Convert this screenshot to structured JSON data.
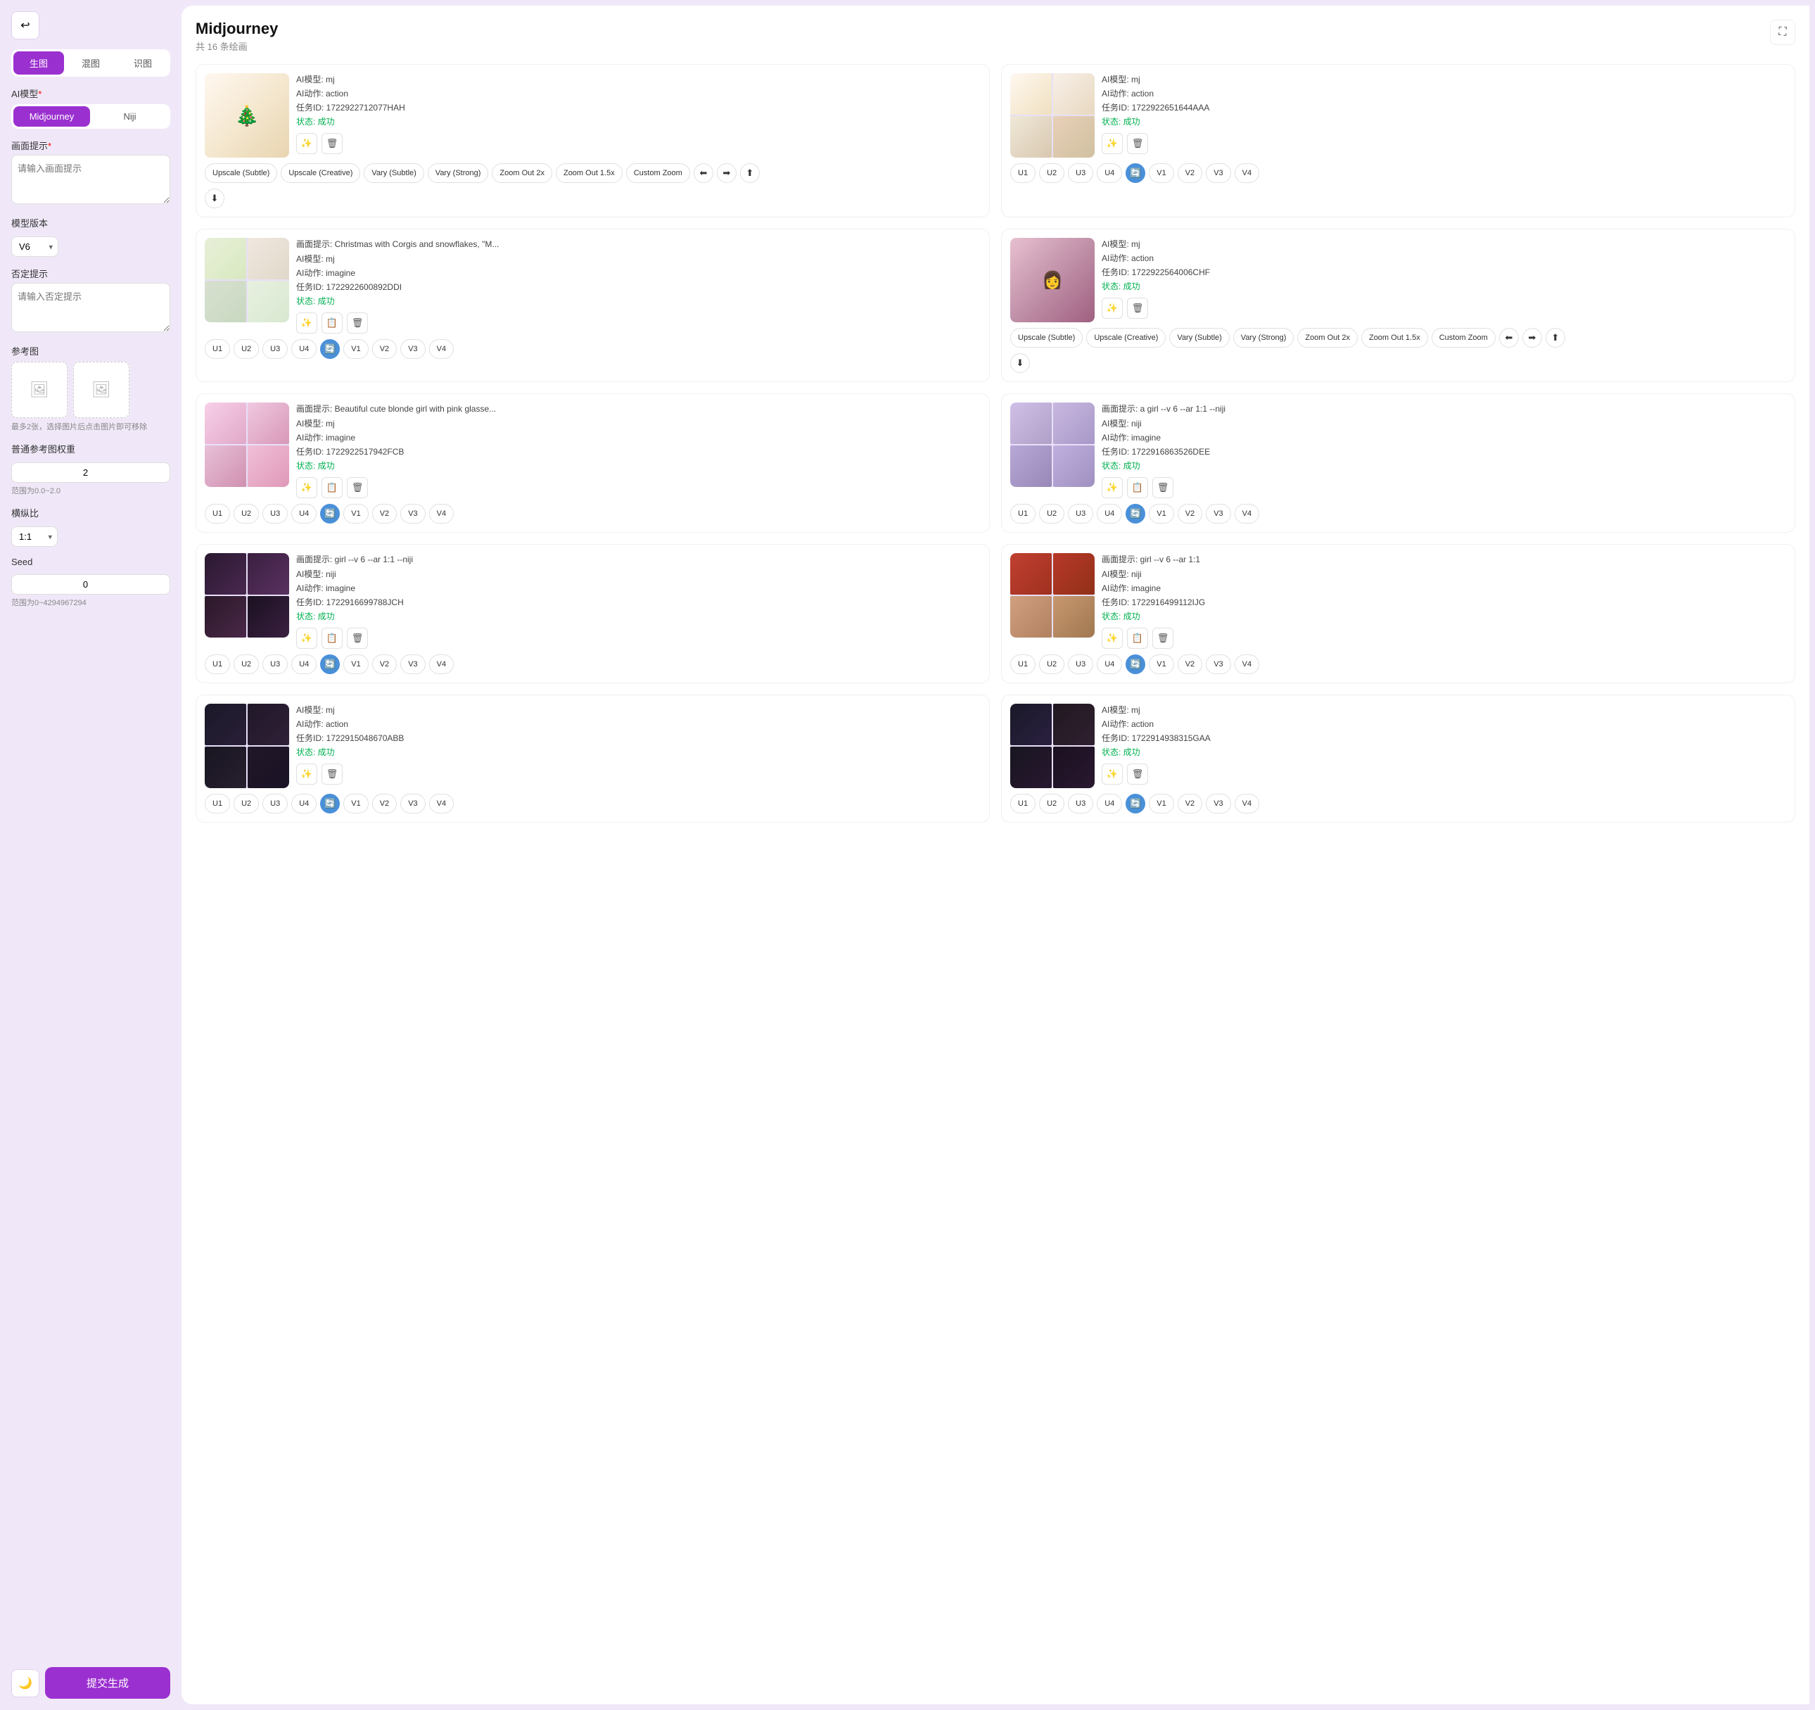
{
  "sidebar": {
    "back_icon": "↩",
    "tabs": [
      "生图",
      "混图",
      "识图"
    ],
    "active_tab": 0,
    "ai_model_label": "AI模型",
    "models": [
      "Midjourney",
      "Niji"
    ],
    "active_model": 0,
    "prompt_label": "画面提示",
    "prompt_placeholder": "请输入画面提示",
    "version_label": "模型版本",
    "version_default": "V6",
    "negative_label": "否定提示",
    "negative_placeholder": "请输入否定提示",
    "ref_label": "参考图",
    "ref_hint": "最多2张，选择图片后点击图片即可移除",
    "ref_weight_label": "普通参考图权重",
    "ref_weight_value": "2",
    "ref_weight_range": "范围为0.0~2.0",
    "aspect_label": "横纵比",
    "aspect_default": "1:1",
    "seed_label": "Seed",
    "seed_value": "0",
    "seed_range": "范围为0~4294967294",
    "submit_label": "提交生成",
    "bottom_icon": "🌙"
  },
  "main": {
    "title": "Midjourney",
    "subtitle": "共 16 条绘画",
    "expand_icon": "⛶",
    "cards": [
      {
        "id": 1,
        "image_type": "christmas_multi",
        "model": "AI模型: mj",
        "action": "AI动作: action",
        "task_id": "任务ID: 1722922712077HAH",
        "status": "状态: 成功",
        "buttons_top": [
          "Upscale (Subtle)",
          "Upscale (Creative)",
          "Vary (Subtle)",
          "Vary (Strong)",
          "Zoom Out 2x",
          "Zoom Out 1.5x",
          "Custom Zoom",
          "⬅",
          "➡",
          "⬆"
        ],
        "buttons_bottom": [
          "⬇"
        ]
      },
      {
        "id": 2,
        "image_type": "christmas_single",
        "model": "AI模型: mj",
        "action": "AI动作: action",
        "task_id": "任务ID: 1722922651644AAA",
        "status": "状态: 成功",
        "buttons_row": [
          "U1",
          "U2",
          "U3",
          "U4",
          "🔄",
          "V1",
          "V2",
          "V3",
          "V4"
        ]
      },
      {
        "id": 3,
        "prompt": "画面提示: Christmas with Corgis and snowflakes, \"M...",
        "image_type": "christmas_grid",
        "model": "AI模型: mj",
        "action": "AI动作: imagine",
        "task_id": "任务ID: 1722922600892DDI",
        "status": "状态: 成功",
        "buttons_row": [
          "U1",
          "U2",
          "U3",
          "U4",
          "🔄",
          "V1",
          "V2",
          "V3",
          "V4"
        ]
      },
      {
        "id": 4,
        "image_type": "girl_portrait",
        "model": "AI模型: mj",
        "action": "AI动作: action",
        "task_id": "任务ID: 1722922564006CHF",
        "status": "状态: 成功",
        "buttons_top": [
          "Upscale (Subtle)",
          "Upscale (Creative)",
          "Vary (Subtle)",
          "Vary (Strong)",
          "Zoom Out 2x",
          "Zoom Out 1.5x",
          "Custom Zoom",
          "⬅",
          "➡",
          "⬆"
        ],
        "buttons_bottom": [
          "⬇"
        ]
      },
      {
        "id": 5,
        "prompt": "画面提示: Beautiful cute blonde girl with pink glasse...",
        "image_type": "girl_pink_grid",
        "model": "AI模型: mj",
        "action": "AI动作: imagine",
        "task_id": "任务ID: 1722922517942FCB",
        "status": "状态: 成功",
        "buttons_row": [
          "U1",
          "U2",
          "U3",
          "U4",
          "🔄",
          "V1",
          "V2",
          "V3",
          "V4"
        ]
      },
      {
        "id": 6,
        "prompt": "画面提示: a girl --v 6 --ar 1:1 --niji",
        "image_type": "girl_niji_grid",
        "model": "AI模型: niji",
        "action": "AI动作: imagine",
        "task_id": "任务ID: 1722916863526DEE",
        "status": "状态: 成功",
        "buttons_row": [
          "U1",
          "U2",
          "U3",
          "U4",
          "🔄",
          "V1",
          "V2",
          "V3",
          "V4"
        ]
      },
      {
        "id": 7,
        "prompt": "画面提示: girl --v 6 --ar 1:1 --niji",
        "image_type": "girl_dark_grid",
        "model": "AI模型: niji",
        "action": "AI动作: imagine",
        "task_id": "任务ID: 1722916699788JCH",
        "status": "状态: 成功",
        "buttons_row": [
          "U1",
          "U2",
          "U3",
          "U4",
          "🔄",
          "V1",
          "V2",
          "V3",
          "V4"
        ]
      },
      {
        "id": 8,
        "prompt": "画面提示: girl --v 6 --ar 1:1",
        "image_type": "girl_red_grid",
        "model": "AI模型: niji",
        "action": "AI动作: imagine",
        "task_id": "任务ID: 1722916499112IJG",
        "status": "状态: 成功",
        "buttons_row": [
          "U1",
          "U2",
          "U3",
          "U4",
          "🔄",
          "V1",
          "V2",
          "V3",
          "V4"
        ]
      },
      {
        "id": 9,
        "image_type": "man_grid",
        "model": "AI模型: mj",
        "action": "AI动作: action",
        "task_id": "任务ID: 1722915048670ABB",
        "status": "状态: 成功",
        "buttons_row": [
          "U1",
          "U2",
          "U3",
          "U4",
          "🔄",
          "V1",
          "V2",
          "V3",
          "V4"
        ]
      },
      {
        "id": 10,
        "image_type": "man_grid2",
        "model": "AI模型: mj",
        "action": "AI动作: action",
        "task_id": "任务ID: 1722914938315GAA",
        "status": "状态: 成功",
        "buttons_row": [
          "U1",
          "U2",
          "U3",
          "U4",
          "🔄",
          "V1",
          "V2",
          "V3",
          "V4"
        ]
      }
    ]
  }
}
